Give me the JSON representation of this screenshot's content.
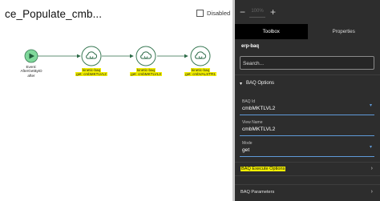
{
  "workflow": {
    "title": "ce_Populate_cmb...",
    "disabled_label": "Disabled",
    "start_node": {
      "lines": [
        "Event:",
        "AfterGetByID",
        "after"
      ]
    },
    "nodes": [
      {
        "lines": [
          "kinetic-baq",
          "get: cmbMKTLVL2"
        ]
      },
      {
        "lines": [
          "kinetic-baq",
          "get: cmbMKTLVL3"
        ]
      },
      {
        "lines": [
          "kinetic-baq",
          "get: cmbVALSTR1"
        ]
      }
    ]
  },
  "panel": {
    "zoom": {
      "minus": "−",
      "value": "100%",
      "plus": "+"
    },
    "tabs": [
      "Toolbox",
      "Properties"
    ],
    "component": "erp-baq",
    "search": {
      "placeholder": "Search..."
    },
    "section": {
      "title": "BAQ Options",
      "chevron": "▾"
    },
    "fields": [
      {
        "label": "BAQ Id",
        "value": "cmbMKTLVL2",
        "chevron": "▾"
      },
      {
        "label": "View Name",
        "value": "cmbMKTLVL2"
      },
      {
        "label": "Mode",
        "value": "get",
        "chevron": "▾"
      }
    ],
    "exec": {
      "label": "BAQ Execute Options",
      "chevron": "›"
    },
    "params": {
      "label": "BAQ Parameters",
      "chevron": "›"
    }
  },
  "colors": {
    "highlight": "#f4f000",
    "accent": "#5f9ad8",
    "node_stroke": "#3a7a55",
    "start_fill": "#7fd89a",
    "panel_bg": "#2d2d2d"
  }
}
